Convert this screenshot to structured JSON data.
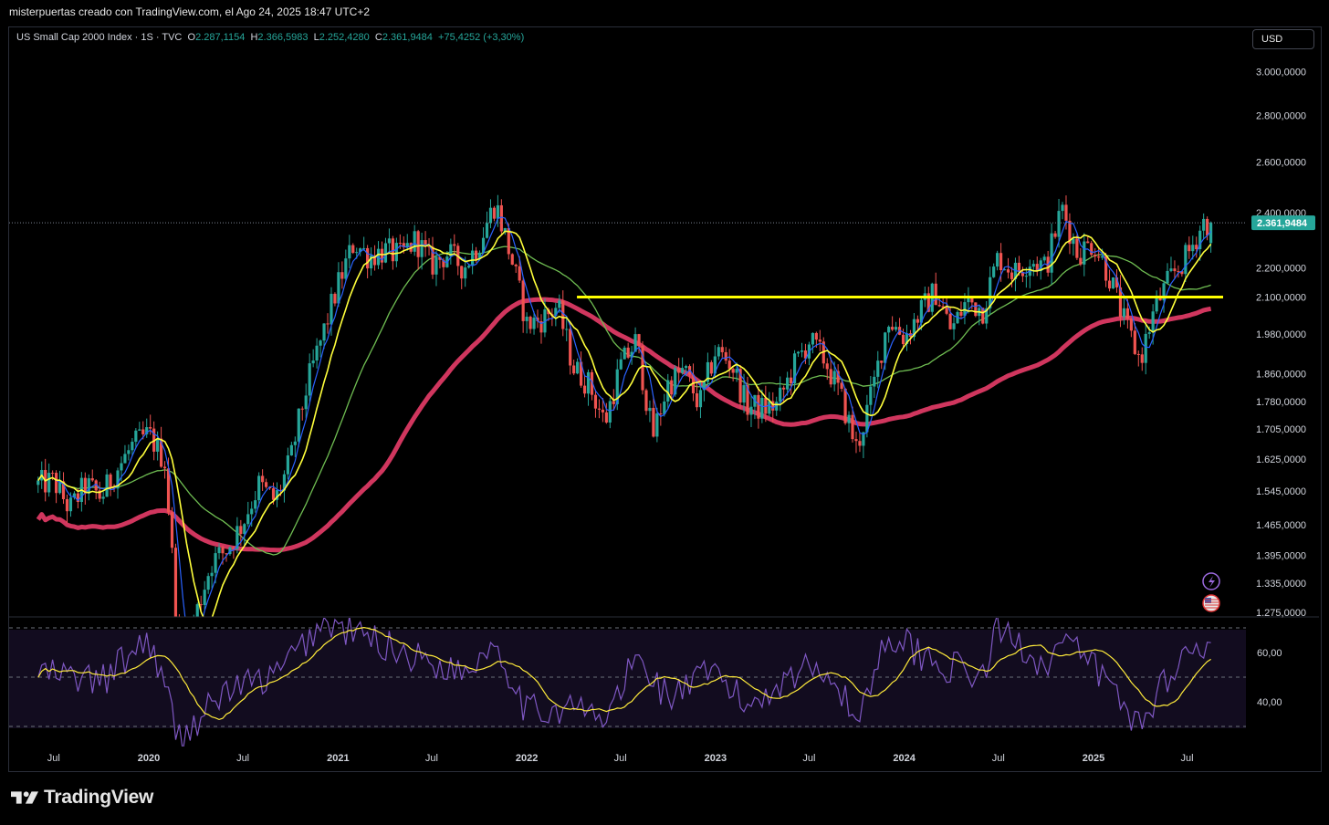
{
  "caption": "misterpuertas creado con TradingView.com, el Ago 24, 2025 18:47 UTC+2",
  "legend": {
    "symbol": "US Small Cap 2000 Index · 1S · TVC",
    "o_label": "O",
    "o_value": "2.287,1154",
    "h_label": "H",
    "h_value": "2.366,5983",
    "l_label": "L",
    "l_value": "2.252,4280",
    "c_label": "C",
    "c_value": "2.361,9484",
    "change": "+75,4252 (+3,30%)"
  },
  "currency_button": "USD",
  "price_badge": "2.361,9484",
  "brand": "TradingView",
  "colors": {
    "up": "#26a69a",
    "down": "#ef5350",
    "ma_blue": "#2962ff",
    "ma_yellow": "#ffff3b",
    "ma_green": "#6fbd52",
    "ma_red": "#d0365e",
    "support": "#ffff00",
    "rsi": "#7e57c2",
    "rsi_ma": "#ffeb3b"
  },
  "chart_data": [
    {
      "type": "candlestick",
      "timeframe": "weekly",
      "series_name": "US Small Cap 2000 Index",
      "y_scale": "log",
      "ylim": [
        1275,
        3000
      ],
      "y_ticks": [
        "3.000,0000",
        "2.800,0000",
        "2.600,0000",
        "2.400,0000",
        "2.200,0000",
        "2.100,0000",
        "1.980,0000",
        "1.860,0000",
        "1.780,0000",
        "1.705,0000",
        "1.625,0000",
        "1.545,0000",
        "1.465,0000",
        "1.395,0000",
        "1.335,0000",
        "1.275,0000"
      ],
      "y_tick_values": [
        3000,
        2800,
        2600,
        2400,
        2200,
        2100,
        1980,
        1860,
        1780,
        1705,
        1625,
        1545,
        1465,
        1395,
        1335,
        1275
      ],
      "x_ticks": [
        "Jul",
        "2020",
        "Jul",
        "2021",
        "Jul",
        "2022",
        "Jul",
        "2023",
        "Jul",
        "2024",
        "Jul",
        "2025",
        "Jul"
      ],
      "x_tick_dates": [
        "2019-07",
        "2020-01",
        "2020-07",
        "2021-01",
        "2021-07",
        "2022-01",
        "2022-07",
        "2023-01",
        "2023-07",
        "2024-01",
        "2024-07",
        "2025-01",
        "2025-07"
      ],
      "approx_close_path": [
        [
          "2019-06",
          1560
        ],
        [
          "2019-07",
          1570
        ],
        [
          "2019-08",
          1500
        ],
        [
          "2019-09",
          1560
        ],
        [
          "2019-10",
          1530
        ],
        [
          "2019-11",
          1600
        ],
        [
          "2019-12",
          1660
        ],
        [
          "2020-01",
          1690
        ],
        [
          "2020-02",
          1620
        ],
        [
          "2020-03",
          1150
        ],
        [
          "2020-04",
          1270
        ],
        [
          "2020-05",
          1380
        ],
        [
          "2020-06",
          1410
        ],
        [
          "2020-07",
          1470
        ],
        [
          "2020-08",
          1560
        ],
        [
          "2020-09",
          1520
        ],
        [
          "2020-10",
          1620
        ],
        [
          "2020-11",
          1820
        ],
        [
          "2020-12",
          1970
        ],
        [
          "2021-01",
          2140
        ],
        [
          "2021-02",
          2290
        ],
        [
          "2021-03",
          2240
        ],
        [
          "2021-04",
          2260
        ],
        [
          "2021-05",
          2240
        ],
        [
          "2021-06",
          2300
        ],
        [
          "2021-07",
          2210
        ],
        [
          "2021-08",
          2250
        ],
        [
          "2021-09",
          2200
        ],
        [
          "2021-10",
          2290
        ],
        [
          "2021-11",
          2440
        ],
        [
          "2021-12",
          2240
        ],
        [
          "2022-01",
          2010
        ],
        [
          "2022-02",
          2030
        ],
        [
          "2022-03",
          2070
        ],
        [
          "2022-04",
          1880
        ],
        [
          "2022-05",
          1830
        ],
        [
          "2022-06",
          1720
        ],
        [
          "2022-07",
          1880
        ],
        [
          "2022-08",
          1960
        ],
        [
          "2022-09",
          1680
        ],
        [
          "2022-10",
          1830
        ],
        [
          "2022-11",
          1870
        ],
        [
          "2022-12",
          1770
        ],
        [
          "2023-01",
          1930
        ],
        [
          "2023-02",
          1890
        ],
        [
          "2023-03",
          1770
        ],
        [
          "2023-04",
          1760
        ],
        [
          "2023-05",
          1770
        ],
        [
          "2023-06",
          1880
        ],
        [
          "2023-07",
          1960
        ],
        [
          "2023-08",
          1900
        ],
        [
          "2023-09",
          1790
        ],
        [
          "2023-10",
          1650
        ],
        [
          "2023-11",
          1810
        ],
        [
          "2023-12",
          2030
        ],
        [
          "2024-01",
          1970
        ],
        [
          "2024-02",
          2050
        ],
        [
          "2024-03",
          2120
        ],
        [
          "2024-04",
          1990
        ],
        [
          "2024-05",
          2090
        ],
        [
          "2024-06",
          2060
        ],
        [
          "2024-07",
          2240
        ],
        [
          "2024-08",
          2180
        ],
        [
          "2024-09",
          2230
        ],
        [
          "2024-10",
          2200
        ],
        [
          "2024-11",
          2420
        ],
        [
          "2024-12",
          2250
        ],
        [
          "2025-01",
          2290
        ],
        [
          "2025-02",
          2170
        ],
        [
          "2025-03",
          2020
        ],
        [
          "2025-04",
          1900
        ],
        [
          "2025-05",
          2070
        ],
        [
          "2025-06",
          2170
        ],
        [
          "2025-07",
          2240
        ],
        [
          "2025-08",
          2362
        ]
      ],
      "support_level": 2100,
      "last_close": 2361.9484,
      "moving_averages": [
        {
          "color": "blue"
        },
        {
          "color": "yellow"
        },
        {
          "color": "green"
        },
        {
          "color": "red"
        }
      ]
    },
    {
      "type": "line",
      "indicator": "RSI",
      "y_ticks": [
        "60,00",
        "40,00"
      ],
      "y_tick_values": [
        60,
        40
      ],
      "bands": [
        70,
        50,
        30
      ],
      "approx_path": [
        [
          "2019-06",
          52
        ],
        [
          "2019-10",
          48
        ],
        [
          "2020-01",
          66
        ],
        [
          "2020-03",
          25
        ],
        [
          "2020-06",
          45
        ],
        [
          "2020-09",
          50
        ],
        [
          "2020-12",
          72
        ],
        [
          "2021-03",
          66
        ],
        [
          "2021-06",
          58
        ],
        [
          "2021-09",
          52
        ],
        [
          "2021-11",
          65
        ],
        [
          "2022-01",
          36
        ],
        [
          "2022-04",
          38
        ],
        [
          "2022-06",
          32
        ],
        [
          "2022-08",
          58
        ],
        [
          "2022-10",
          42
        ],
        [
          "2023-01",
          52
        ],
        [
          "2023-03",
          38
        ],
        [
          "2023-06",
          52
        ],
        [
          "2023-08",
          55
        ],
        [
          "2023-10",
          32
        ],
        [
          "2023-12",
          68
        ],
        [
          "2024-03",
          56
        ],
        [
          "2024-06",
          50
        ],
        [
          "2024-07",
          70
        ],
        [
          "2024-10",
          55
        ],
        [
          "2024-11",
          64
        ],
        [
          "2025-01",
          55
        ],
        [
          "2025-04",
          30
        ],
        [
          "2025-06",
          54
        ],
        [
          "2025-08",
          64
        ]
      ]
    }
  ]
}
